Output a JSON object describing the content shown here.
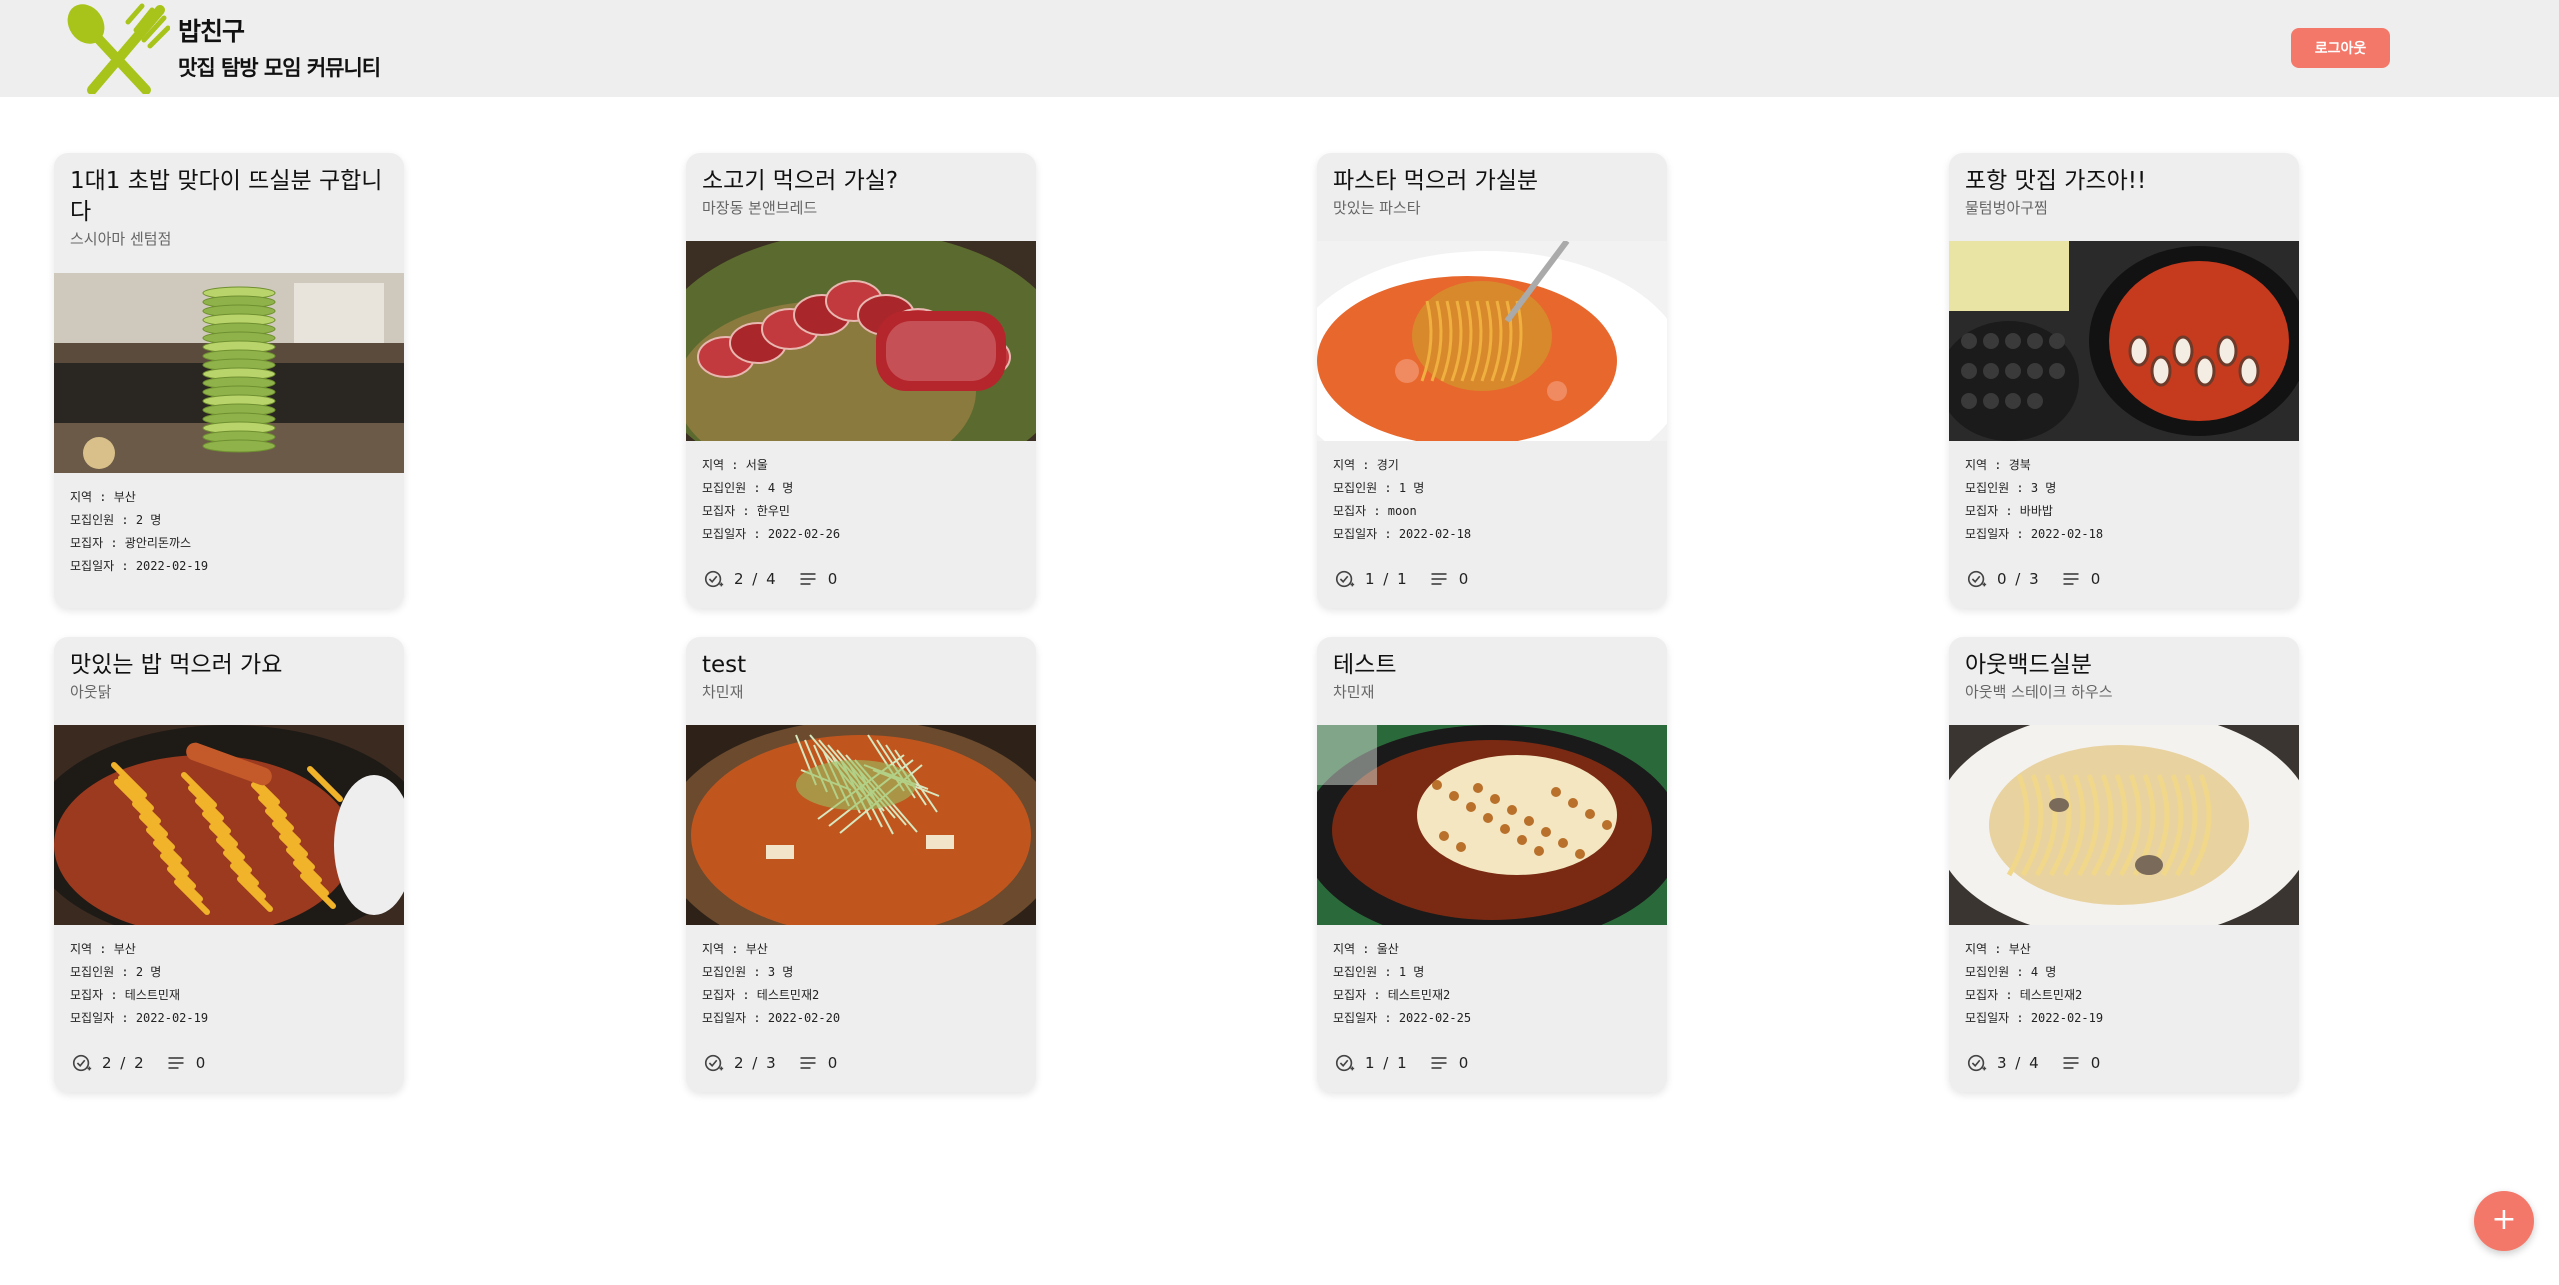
{
  "header": {
    "brand_name": "밥친구",
    "brand_tagline": "맛집 탐방 모임 커뮤니티",
    "logout_label": "로그아웃"
  },
  "fab": {
    "label": "+"
  },
  "posts": [
    {
      "title": "1대1 초밥 맞다이 뜨실분 구합니다",
      "restaurant": "스시아마 센텀점",
      "region": "지역 : 부산",
      "capacity": "모집인원 : 2 명",
      "host": "모집자 : 광안리돈까스",
      "deadline": "모집일자 : 2022-02-19",
      "participants": "",
      "comments": "",
      "photo": "sushi plates"
    },
    {
      "title": "소고기 먹으러 가실?",
      "restaurant": "마장동 본앤브레드",
      "region": "지역 : 서울",
      "capacity": "모집인원 : 4 명",
      "host": "모집자 : 한우민",
      "deadline": "모집일자 : 2022-02-26",
      "participants": "2 / 4",
      "comments": "0",
      "photo": "raw beef"
    },
    {
      "title": "파스타 먹으러 가실분",
      "restaurant": "맛있는 파스타",
      "region": "지역 : 경기",
      "capacity": "모집인원 : 1 명",
      "host": "모집자 : moon",
      "deadline": "모집일자 : 2022-02-18",
      "participants": "1 / 1",
      "comments": "0",
      "photo": "tomato pasta"
    },
    {
      "title": "포항 맛집 가즈아!!",
      "restaurant": "물텀벙아구찜",
      "region": "지역 : 경북",
      "capacity": "모집인원 : 3 명",
      "host": "모집자 : 바바밥",
      "deadline": "모집일자 : 2022-02-18",
      "participants": "0 / 3",
      "comments": "0",
      "photo": "spicy octopus"
    },
    {
      "title": "맛있는 밥 먹으러 가요",
      "restaurant": "아웃닭",
      "region": "지역 : 부산",
      "capacity": "모집인원 : 2 명",
      "host": "모집자 : 테스트민재",
      "deadline": "모집일자 : 2022-02-19",
      "participants": "2 / 2",
      "comments": "0",
      "photo": "fries chicken"
    },
    {
      "title": "test",
      "restaurant": "차민재",
      "region": "지역 : 부산",
      "capacity": "모집인원 : 3 명",
      "host": "모집자 : 테스트민재2",
      "deadline": "모집일자 : 2022-02-20",
      "participants": "2 / 3",
      "comments": "0",
      "photo": "spicy stew"
    },
    {
      "title": "테스트",
      "restaurant": "차민재",
      "region": "지역 : 울산",
      "capacity": "모집인원 : 1 명",
      "host": "모집자 : 테스트민재2",
      "deadline": "모집일자 : 2022-02-25",
      "participants": "1 / 1",
      "comments": "0",
      "photo": "cheese dish"
    },
    {
      "title": "아웃백드실분",
      "restaurant": "아웃백 스테이크 하우스",
      "region": "지역 : 부산",
      "capacity": "모집인원 : 4 명",
      "host": "모집자 : 테스트민재2",
      "deadline": "모집일자 : 2022-02-19",
      "participants": "3 / 4",
      "comments": "0",
      "photo": "cream pasta"
    }
  ],
  "colors": {
    "accent": "#f4786a",
    "logo_green": "#a8c41a",
    "header_bg": "#eeeeee",
    "card_bg": "#eeeeee"
  }
}
